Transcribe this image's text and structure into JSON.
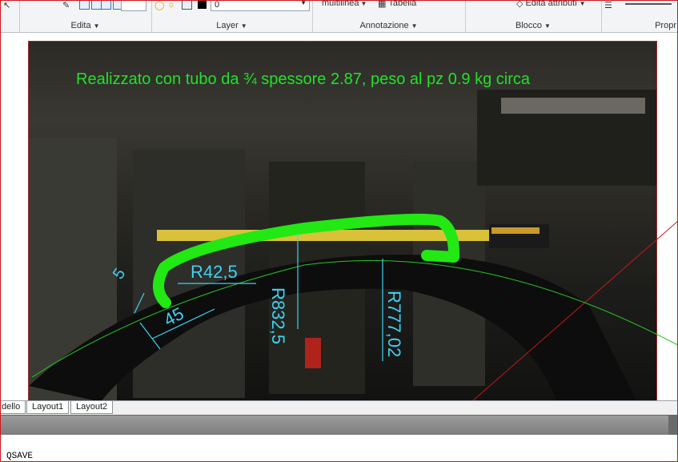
{
  "ribbon": {
    "groups": [
      {
        "label": "Edita"
      },
      {
        "label": "Layer"
      },
      {
        "label": "Annotazione"
      },
      {
        "label": "Blocco"
      },
      {
        "label": "Propr"
      }
    ],
    "layer_value": "0",
    "multiline_label": "multilinea",
    "table_label": "Tabella",
    "edit_attributes_label": "Edita attributi"
  },
  "drawing": {
    "caption": "Realizzato con tubo da ¾  spessore 2.87, peso al pz 0.9 kg circa",
    "dimensions": {
      "dim_5": "5",
      "dim_45": "45",
      "r_42_5": "R42,5",
      "r_832_5": "R832,5",
      "r_777_02": "R777,02"
    },
    "colors": {
      "caption": "#22e02a",
      "tube": "#22e814",
      "dimension": "#3fd2f2",
      "arc_green": "#27c427",
      "arc_red": "#c81818"
    }
  },
  "tabs": [
    "dello",
    "Layout1",
    "Layout2"
  ],
  "command_line": {
    "text": "QSAVE"
  }
}
